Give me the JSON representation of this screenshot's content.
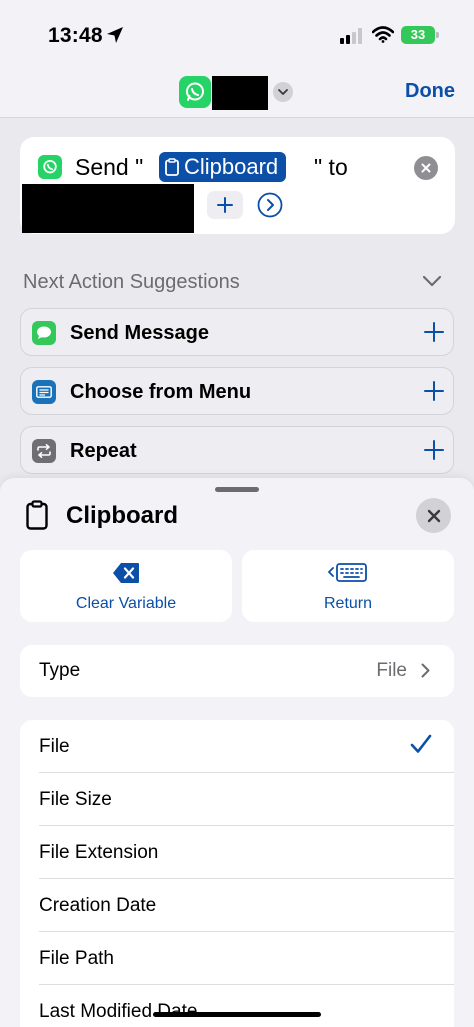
{
  "status_bar": {
    "time": "13:48",
    "battery": "33"
  },
  "nav": {
    "done_label": "Done"
  },
  "action": {
    "send_prefix": "Send \"",
    "variable_label": "Clipboard",
    "to_suffix": "\" to"
  },
  "suggestions": {
    "header": "Next Action Suggestions",
    "items": [
      {
        "label": "Send Message",
        "icon": "messages-icon",
        "color": "#34c759"
      },
      {
        "label": "Choose from Menu",
        "icon": "menu-icon",
        "color": "#1a73b8"
      },
      {
        "label": "Repeat",
        "icon": "repeat-icon",
        "color": "#6e6e73"
      }
    ]
  },
  "sheet": {
    "title": "Clipboard",
    "clear_variable": "Clear Variable",
    "return_label": "Return",
    "type_label": "Type",
    "type_value": "File",
    "options": [
      {
        "label": "File",
        "selected": true
      },
      {
        "label": "File Size",
        "selected": false
      },
      {
        "label": "File Extension",
        "selected": false
      },
      {
        "label": "Creation Date",
        "selected": false
      },
      {
        "label": "File Path",
        "selected": false
      },
      {
        "label": "Last Modified Date",
        "selected": false
      }
    ]
  },
  "colors": {
    "accent": "#0b4fa8",
    "whatsapp": "#25d366",
    "battery": "#34c759"
  }
}
